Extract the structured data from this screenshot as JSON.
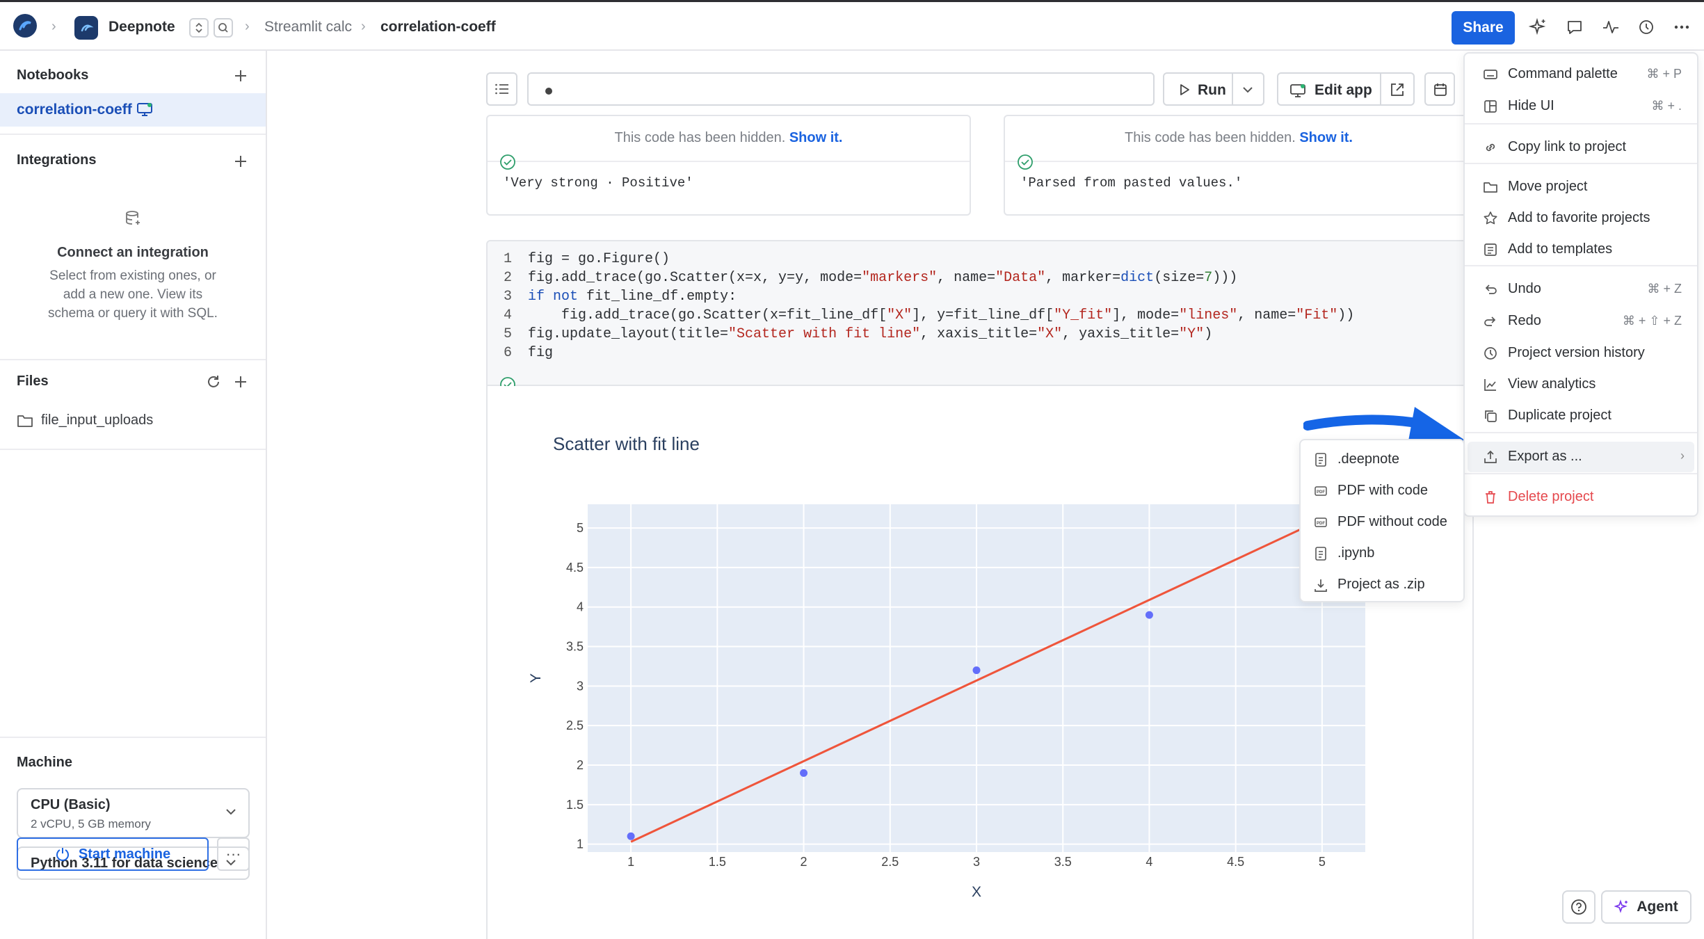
{
  "topbar": {
    "app_name": "Deepnote",
    "breadcrumb": [
      "Streamlit calc",
      "correlation-coeff"
    ],
    "share_label": "Share"
  },
  "sidebar": {
    "notebooks_title": "Notebooks",
    "active_notebook": "correlation-coeff",
    "integrations_title": "Integrations",
    "integrations_empty_title": "Connect an integration",
    "integrations_empty_text": [
      "Select from existing ones, or",
      "add a new one. View its",
      "schema or query it with SQL."
    ],
    "files_title": "Files",
    "files": [
      "file_input_uploads"
    ],
    "machine_title": "Machine",
    "machine_type": "CPU (Basic)",
    "machine_spec": "2 vCPU, 5 GB memory",
    "environment": "Python 3.11 for data science",
    "start_label": "Start machine",
    "more_label": "···"
  },
  "toolbar": {
    "run_label": "Run",
    "edit_app_label": "Edit app"
  },
  "blocks": [
    {
      "hidden_text": "This code has been hidden.",
      "show_link": "Show it.",
      "output": "'Very strong · Positive'"
    },
    {
      "hidden_text": "This code has been hidden.",
      "show_link": "Show it.",
      "output": "'Parsed from pasted values.'"
    }
  ],
  "code_lines": [
    {
      "n": "1",
      "text": "fig = go.Figure()"
    },
    {
      "n": "2",
      "text": "fig.add_trace(go.Scatter(x=x, y=y, mode=\"markers\", name=\"Data\", marker=dict(size=7)))"
    },
    {
      "n": "3",
      "text": "if not fit_line_df.empty:"
    },
    {
      "n": "4",
      "text": "    fig.add_trace(go.Scatter(x=fit_line_df[\"X\"], y=fit_line_df[\"Y_fit\"], mode=\"lines\", name=\"Fit\"))"
    },
    {
      "n": "5",
      "text": "fig.update_layout(title=\"Scatter with fit line\", xaxis_title=\"X\", yaxis_title=\"Y\")"
    },
    {
      "n": "6",
      "text": "fig"
    }
  ],
  "chart_data": {
    "type": "scatter",
    "title": "Scatter with fit line",
    "xlabel": "X",
    "ylabel": "Y",
    "xlim": [
      0.75,
      5.25
    ],
    "ylim": [
      0.9,
      5.3
    ],
    "xticks": [
      "1",
      "1.5",
      "2",
      "2.5",
      "3",
      "3.5",
      "4",
      "4.5",
      "5"
    ],
    "yticks": [
      "1",
      "1.5",
      "2",
      "2.5",
      "3",
      "3.5",
      "4",
      "4.5",
      "5"
    ],
    "grid": true,
    "series": [
      {
        "type": "markers",
        "x": [
          1,
          2,
          3,
          4
        ],
        "y": [
          1.1,
          1.9,
          3.2,
          3.9
        ],
        "color": "#636efa"
      },
      {
        "type": "line",
        "x": [
          1,
          5
        ],
        "y": [
          1.03,
          5.11
        ],
        "color": "#ef553b"
      }
    ]
  },
  "menu": {
    "items": [
      {
        "label": "Command palette",
        "shortcut": "⌘ + P",
        "icon": "keyboard-icon"
      },
      {
        "label": "Hide UI",
        "shortcut": "⌘ + .",
        "icon": "layout-icon"
      },
      {
        "label": "Copy link to project",
        "icon": "link-icon"
      },
      {
        "label": "Move project",
        "icon": "folder-icon"
      },
      {
        "label": "Add to favorite projects",
        "icon": "star-icon"
      },
      {
        "label": "Add to templates",
        "icon": "template-icon"
      },
      {
        "label": "Undo",
        "shortcut": "⌘ + Z",
        "icon": "undo-icon"
      },
      {
        "label": "Redo",
        "shortcut": "⌘ + ⇧ + Z",
        "icon": "redo-icon"
      },
      {
        "label": "Project version history",
        "icon": "history-icon"
      },
      {
        "label": "View analytics",
        "icon": "chart-icon"
      },
      {
        "label": "Duplicate project",
        "icon": "duplicate-icon"
      },
      {
        "label": "Export as ...",
        "icon": "export-icon"
      },
      {
        "label": "Delete project",
        "icon": "trash-icon"
      }
    ]
  },
  "export_submenu": [
    ".deepnote",
    "PDF with code",
    "PDF without code",
    ".ipynb",
    "Project as .zip"
  ],
  "agent_label": "Agent",
  "colors": {
    "accent": "#1a63e0",
    "danger": "#e5484d",
    "arrow": "#1565e6"
  }
}
